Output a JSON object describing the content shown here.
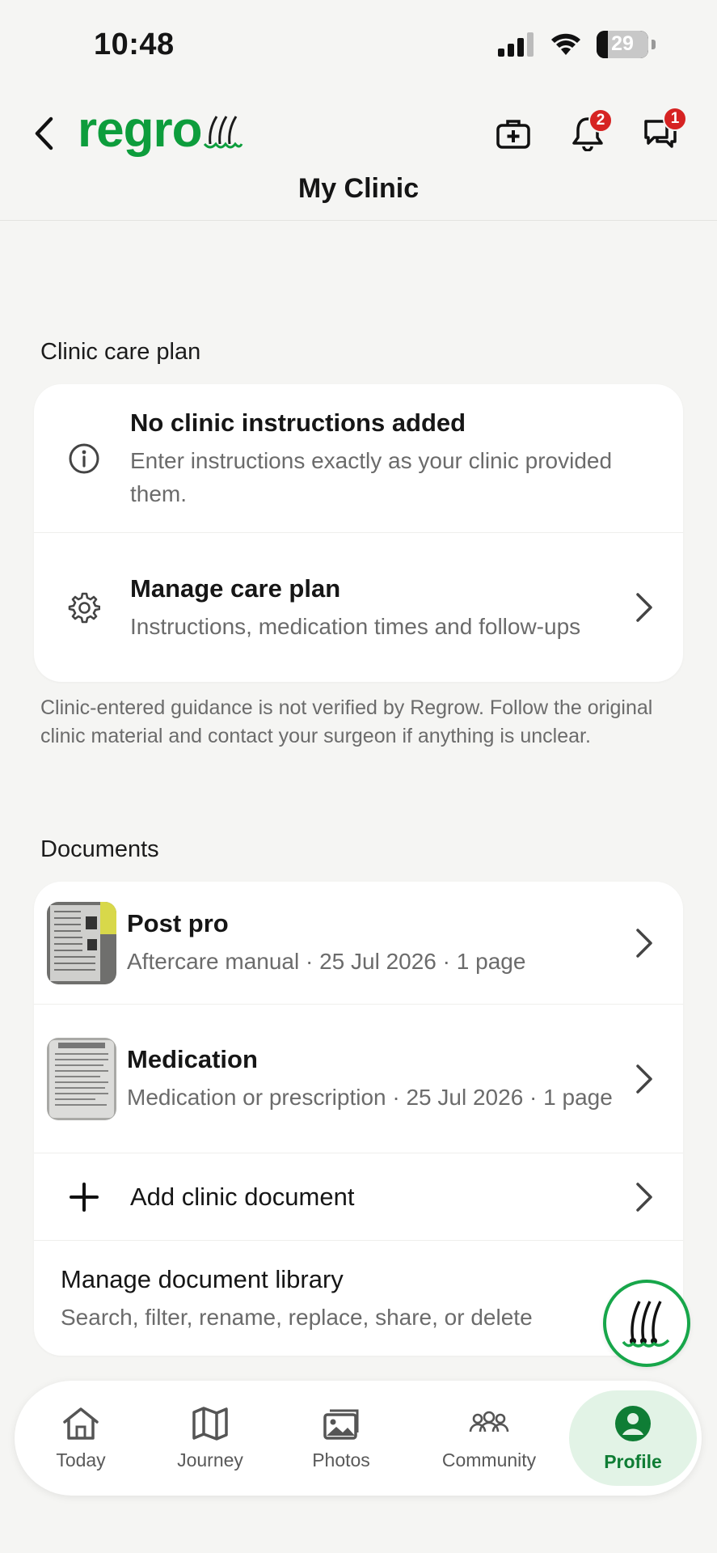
{
  "status_bar": {
    "time": "10:48",
    "battery": "29"
  },
  "header": {
    "logo_main": "regro",
    "title": "My Clinic",
    "notifications_badge": "2",
    "messages_badge": "1"
  },
  "care_plan": {
    "section_title": "Clinic care plan",
    "rows": [
      {
        "title": "No clinic instructions added",
        "subtitle": "Enter instructions exactly as your clinic provided them.",
        "icon": "info-icon"
      },
      {
        "title": "Manage care plan",
        "subtitle": "Instructions, medication times and follow-ups",
        "icon": "gear-icon"
      }
    ],
    "disclaimer": "Clinic-entered guidance is not verified by Regrow. Follow the original clinic material and contact your surgeon if anything is unclear."
  },
  "documents": {
    "section_title": "Documents",
    "items": [
      {
        "title": "Post pro",
        "subtitle": "Aftercare manual · 25 Jul 2026 · 1 page"
      },
      {
        "title": "Medication",
        "subtitle": "Medication or prescription · 25 Jul 2026 · 1 page"
      }
    ],
    "add_label": "Add clinic document",
    "library_title": "Manage document library",
    "library_subtitle": "Search, filter, rename, replace, share, or delete"
  },
  "nav": {
    "tabs": [
      {
        "label": "Today",
        "icon": "home-icon"
      },
      {
        "label": "Journey",
        "icon": "map-icon"
      },
      {
        "label": "Photos",
        "icon": "photos-icon"
      },
      {
        "label": "Community",
        "icon": "people-icon"
      },
      {
        "label": "Profile",
        "icon": "profile-icon"
      }
    ],
    "active": "Profile"
  },
  "colors": {
    "brand_green": "#0d9d3c",
    "badge_red": "#d62322",
    "active_tab_bg": "#e2f3e6"
  }
}
